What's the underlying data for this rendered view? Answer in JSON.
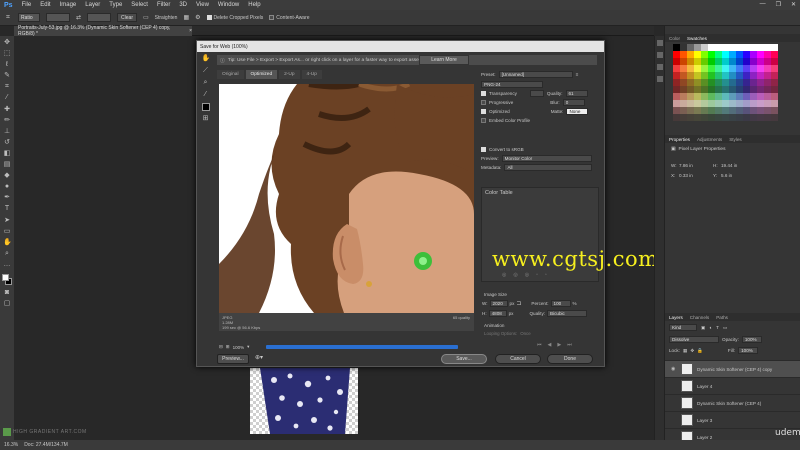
{
  "menubar": {
    "logo": "Ps",
    "items": [
      "File",
      "Edit",
      "Image",
      "Layer",
      "Type",
      "Select",
      "Filter",
      "3D",
      "View",
      "Window",
      "Help"
    ],
    "controls": [
      "—",
      "❐",
      "✕"
    ]
  },
  "optbar": {
    "ratio": "Ratio",
    "clear": "Clear",
    "straighten": "Straighten",
    "delete_cropped": "Delete Cropped Pixels",
    "content_aware": "Content-Aware"
  },
  "doc_tab": {
    "title": "Portraits-July-53.jpg @ 16.3% (Dynamic Skin Softener (CEP 4) copy, RGB/8) *",
    "close": "×"
  },
  "dialog": {
    "title": "Save for Web (100%)",
    "tip": "Tip: Use File > Export > Export As... or right click on a layer for a faster way to export assets",
    "learn_more": "Learn More",
    "tabs": [
      "Original",
      "Optimized",
      "2-Up",
      "4-Up"
    ],
    "preview_info": {
      "line1": "JPEG",
      "line2": "1.28M",
      "line3": "199 sec @ 56.6 Kbps",
      "quality": "65 quality"
    },
    "zoom": "100%",
    "buttons": {
      "preview": "Preview...",
      "save": "Save...",
      "cancel": "Cancel",
      "done": "Done"
    },
    "preset_label": "Preset:",
    "preset_value": "[Unnamed]",
    "format": "PNG-24",
    "transparency": "Transparency",
    "progressive": "Progressive",
    "optimized": "Optimized",
    "embed": "Embed Color Profile",
    "quality_label": "Quality:",
    "quality_value": "61",
    "blur_label": "Blur:",
    "blur_value": "0",
    "matte_label": "Matte:",
    "matte_value": "None",
    "convert": "Convert to sRGB",
    "preview_label": "Preview:",
    "preview_value": "Monitor Color",
    "metadata_label": "Metadata:",
    "metadata_value": "All",
    "color_table": "Color Table",
    "image_size": "Image Size",
    "w_label": "W:",
    "w_value": "2020",
    "w_unit": "px",
    "h_label": "H:",
    "h_value": "4808",
    "h_unit": "px",
    "percent_label": "Percent:",
    "percent_value": "100",
    "percent_unit": "%",
    "quality2_label": "Quality:",
    "quality2_value": "Bicubic",
    "animation": "Animation",
    "looping": "Looping Options:",
    "looping_value": "Once"
  },
  "watermark_overlay": "www.cgtsj.com",
  "right_panel": {
    "color_tabs": [
      "Color",
      "Swatches"
    ],
    "props_tabs": [
      "Properties",
      "Adjustments",
      "Styles"
    ],
    "props_title": "Pixel Layer Properties",
    "props": {
      "w_label": "W:",
      "w": "7.86 in",
      "h_label": "H:",
      "h": "19.44 in",
      "x_label": "X:",
      "x": "0.33 in",
      "y_label": "Y:",
      "y": "5.6 in"
    },
    "layers_tabs": [
      "Layers",
      "Channels",
      "Paths"
    ],
    "kind": "Kind",
    "blend": "Dissolve",
    "opacity_label": "Opacity:",
    "opacity": "100%",
    "lock_label": "Lock:",
    "fill_label": "Fill:",
    "fill": "100%",
    "layers": [
      "Dynamic Skin Softener (CEP 4) copy",
      "Layer 4",
      "Dynamic Skin Softener (CEP 4)",
      "Layer 3",
      "Layer 2"
    ]
  },
  "status": {
    "zoom": "16.3%",
    "doc": "Doc: 27.4M/134.7M"
  },
  "brand_watermark": "HIGH GRADIENT ART.COM",
  "udemy": "udemy"
}
